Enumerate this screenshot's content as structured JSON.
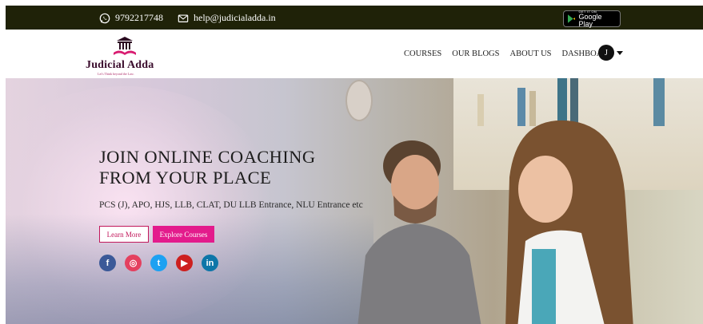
{
  "topbar": {
    "phone": "9792217748",
    "email": "help@judicialadda.in",
    "phone_icon": "whatsapp-icon",
    "email_icon": "mail-icon",
    "store_badge": {
      "small": "GET IT ON",
      "big": "Google Play",
      "icon": "google-play-icon"
    }
  },
  "logo": {
    "name": "Judicial Adda",
    "tagline": "Let's Think beyond the Law.",
    "emblem_icon": "courthouse-book-icon"
  },
  "nav": {
    "items": [
      "COURSES",
      "OUR BLOGS",
      "ABOUT US",
      "DASHBOARD"
    ],
    "avatar_initial": "J"
  },
  "hero": {
    "title": "JOIN ONLINE COACHING FROM YOUR PLACE",
    "subtitle": "PCS (J), APO, HJS, LLB, CLAT, DU LLB Entrance, NLU Entrance etc",
    "learn_more_label": "Learn More",
    "explore_label": "Explore Courses",
    "social": [
      {
        "icon": "facebook-icon",
        "color": "#3b5998",
        "glyph": "f"
      },
      {
        "icon": "instagram-icon",
        "color": "#e4405f",
        "glyph": "◎"
      },
      {
        "icon": "twitter-icon",
        "color": "#1da1f2",
        "glyph": "t"
      },
      {
        "icon": "youtube-icon",
        "color": "#cd201f",
        "glyph": "▶"
      },
      {
        "icon": "linkedin-icon",
        "color": "#0e76a8",
        "glyph": "in"
      }
    ]
  },
  "colors": {
    "topbar_bg": "#1f2208",
    "accent_pink": "#e31b8c",
    "logo_maroon": "#3a0c2c"
  }
}
